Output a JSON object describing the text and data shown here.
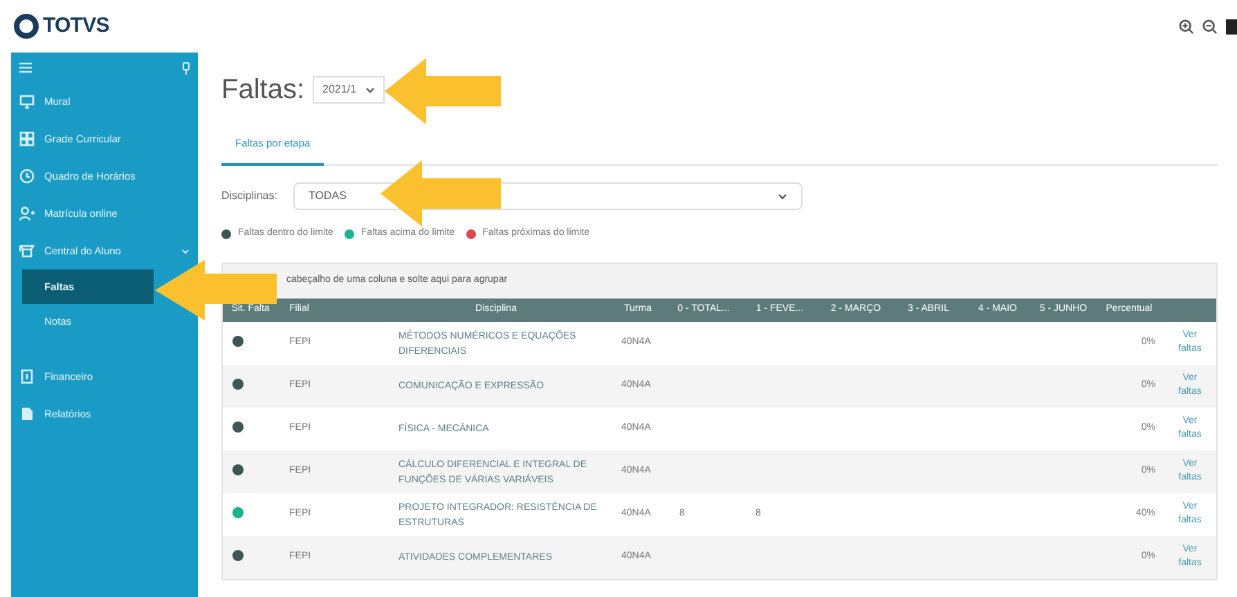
{
  "header": {
    "logo": "TOTVS"
  },
  "sidebar": {
    "items": [
      {
        "label": "Mural",
        "kind": "monitor",
        "selected": false
      },
      {
        "label": "Grade Curricular",
        "kind": "grid",
        "selected": false
      },
      {
        "label": "Quadro de Horários",
        "kind": "clock",
        "selected": false
      },
      {
        "label": "Matrícula online",
        "kind": "user",
        "selected": false
      },
      {
        "label": "Central do Aluno",
        "kind": "cap",
        "selected": false,
        "expanded": true,
        "children": [
          {
            "label": "Faltas",
            "selected": true
          },
          {
            "label": "Notas",
            "selected": false
          }
        ]
      },
      {
        "label": "Financeiro",
        "kind": "doc",
        "selected": false
      },
      {
        "label": "Relatórios",
        "kind": "file",
        "selected": false
      }
    ]
  },
  "page": {
    "title": "Faltas:",
    "period": "2021/1"
  },
  "tabs": [
    {
      "label": "Faltas por etapa",
      "selected": true
    }
  ],
  "filter": {
    "label": "Disciplinas:",
    "value": "TODAS"
  },
  "legend": [
    {
      "label": "Faltas dentro do limite",
      "color": "#3f5656"
    },
    {
      "label": "Faltas acima do limite",
      "color": "#1bb38e"
    },
    {
      "label": "Faltas próximas do limite",
      "color": "#e0474c"
    }
  ],
  "group_bar": "cabeçalho de uma coluna e solte aqui para agrupar",
  "table": {
    "columns": [
      "Sit. Falta",
      "Filial",
      "Disciplina",
      "Turma",
      "0 - TOTAL...",
      "1 - FEVE...",
      "2 - MARÇO",
      "3 - ABRIL",
      "4 - MAIO",
      "5 - JUNHO",
      "Percentual"
    ],
    "rows": [
      {
        "color": "#3f5656",
        "filial": "FEPI",
        "disciplina": "MÉTODOS NUMÉRICOS E EQUAÇÕES DIFERENCIAIS",
        "turma": "40N4A",
        "percentual": "0%",
        "link": "Ver faltas"
      },
      {
        "color": "#3f5656",
        "filial": "FEPI",
        "disciplina": "COMUNICAÇÃO E EXPRESSÃO",
        "turma": "40N4A",
        "percentual": "0%",
        "link": "Ver faltas"
      },
      {
        "color": "#3f5656",
        "filial": "FEPI",
        "disciplina": "FÍSICA - MECÂNICA",
        "turma": "40N4A",
        "percentual": "0%",
        "link": "Ver faltas"
      },
      {
        "color": "#3f5656",
        "filial": "FEPI",
        "disciplina": "CÁLCULO DIFERENCIAL E INTEGRAL DE FUNÇÕES DE VÁRIAS VARIÁVEIS",
        "turma": "40N4A",
        "percentual": "0%",
        "link": "Ver faltas"
      },
      {
        "color": "#1bb38e",
        "filial": "FEPI",
        "disciplina": "PROJETO INTEGRADOR: RESISTÊNCIA DE ESTRUTURAS",
        "turma": "40N4A",
        "total": "8",
        "fevereiro": "8",
        "percentual": "40%",
        "link": "Ver faltas"
      },
      {
        "color": "#3f5656",
        "filial": "FEPI",
        "disciplina": "ATIVIDADES COMPLEMENTARES",
        "turma": "40N4A",
        "percentual": "0%",
        "link": "Ver faltas"
      }
    ]
  }
}
